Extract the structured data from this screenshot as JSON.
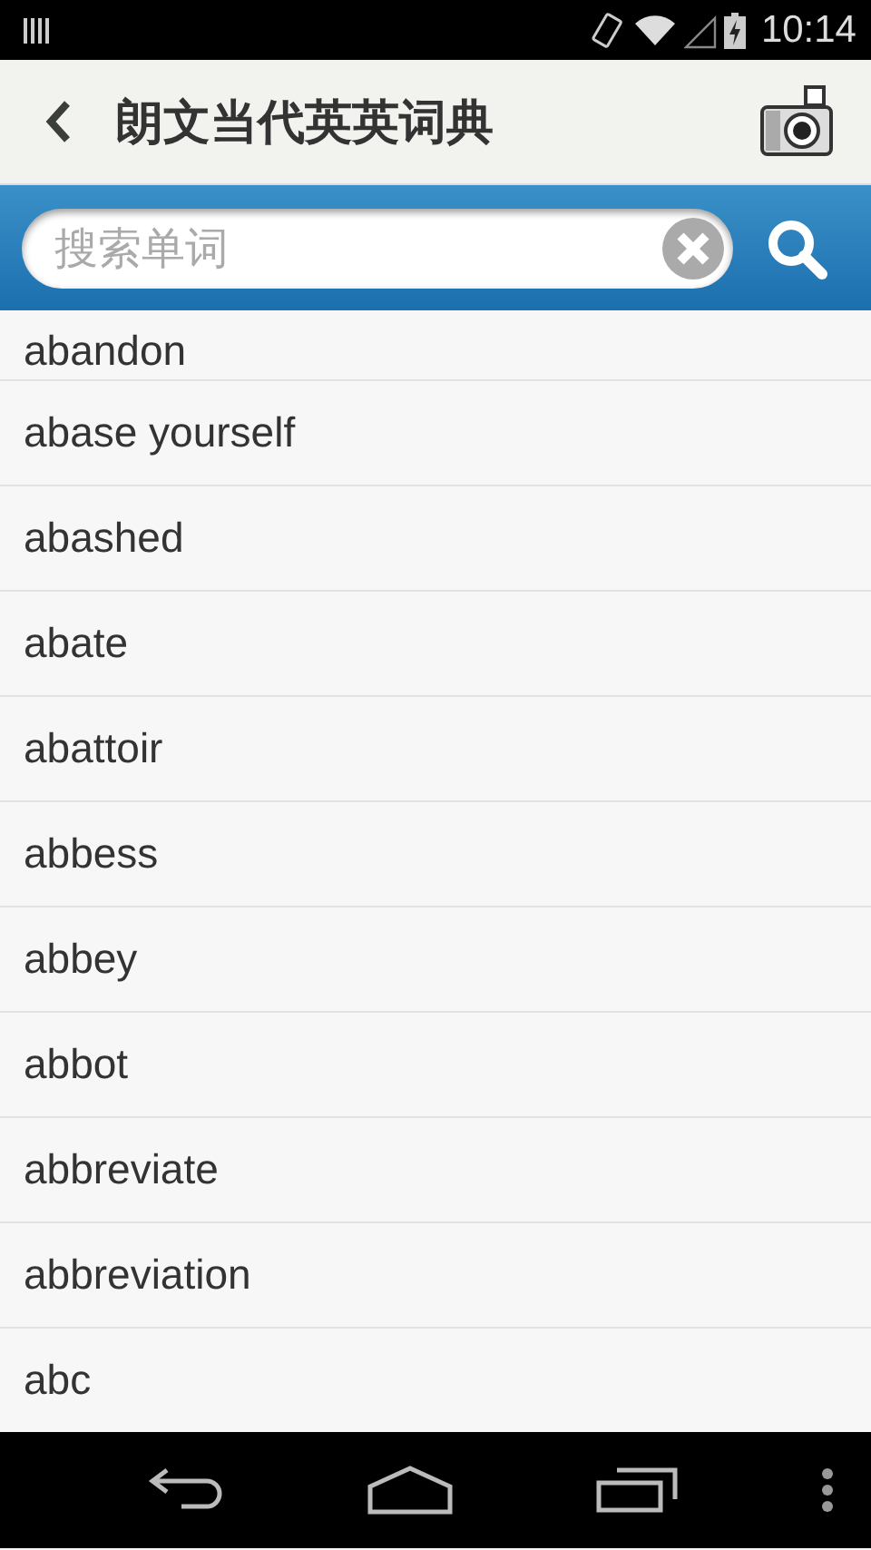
{
  "status_bar": {
    "time": "10:14"
  },
  "header": {
    "title": "朗文当代英英词典"
  },
  "search": {
    "placeholder": "搜索单词"
  },
  "words": [
    "abandon",
    "abase yourself",
    "abashed",
    "abate",
    "abattoir",
    "abbess",
    "abbey",
    "abbot",
    "abbreviate",
    "abbreviation",
    "abc"
  ]
}
